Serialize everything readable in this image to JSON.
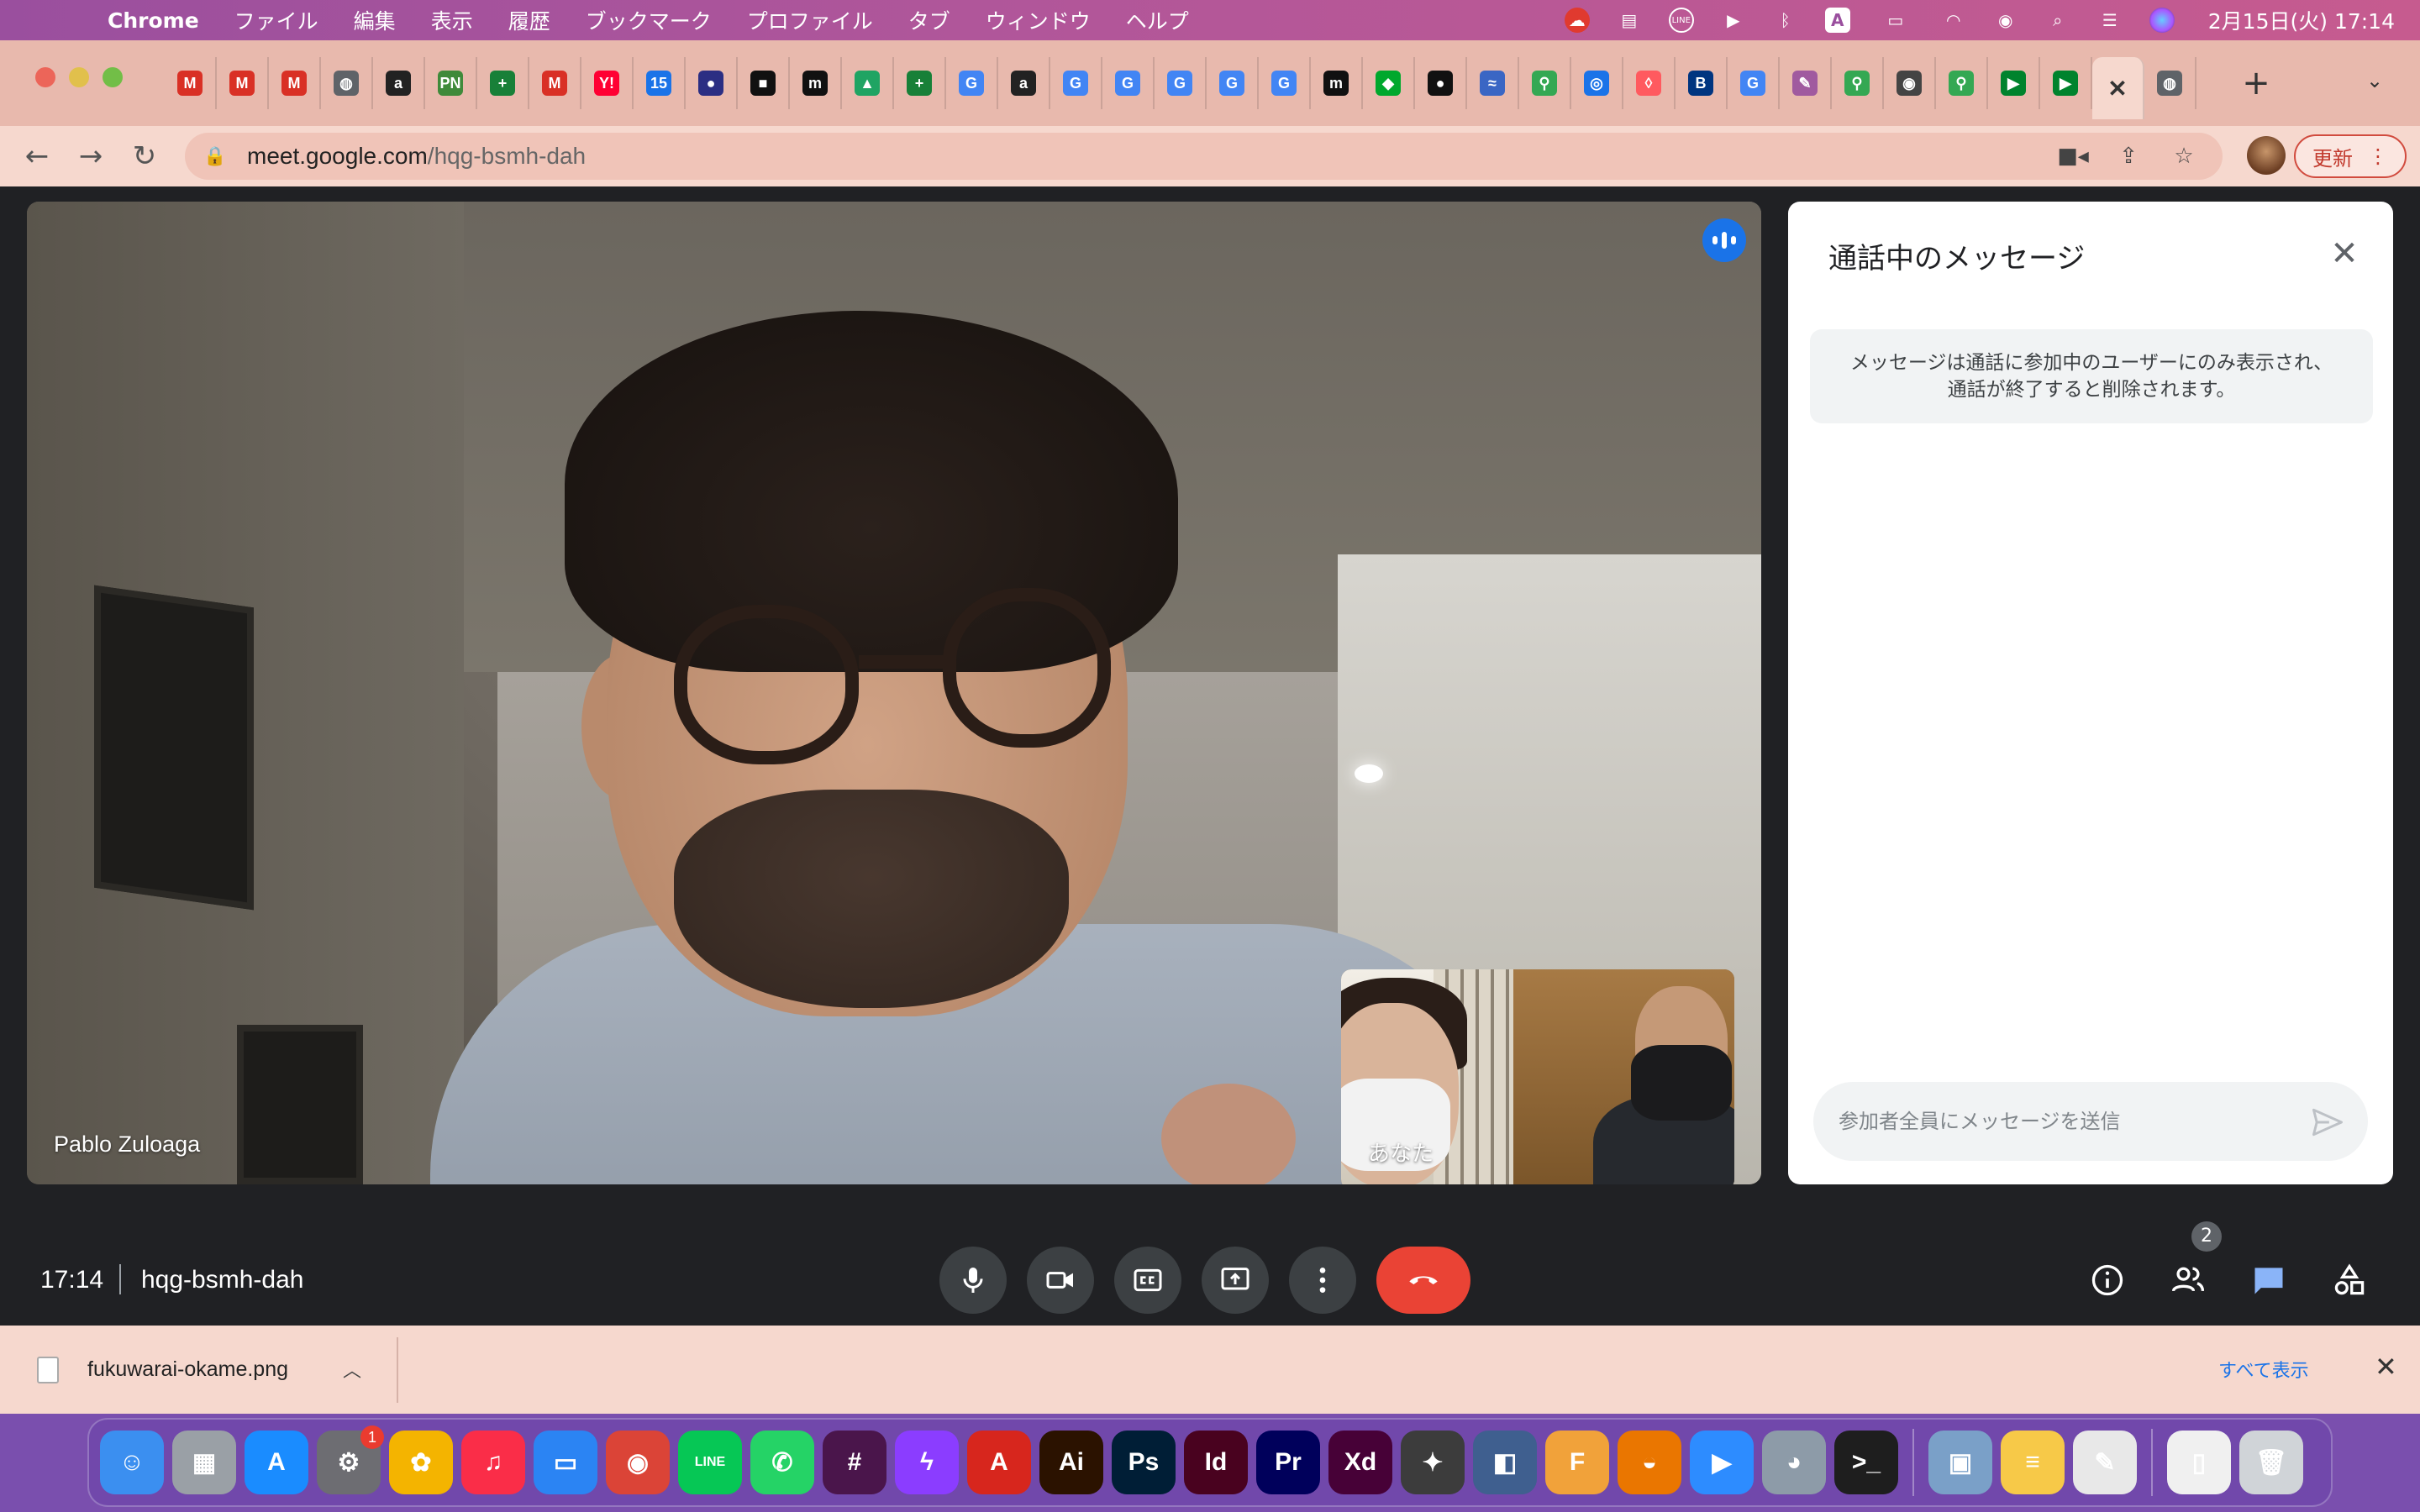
{
  "menubar": {
    "app_name": "Chrome",
    "menus": [
      "ファイル",
      "編集",
      "表示",
      "履歴",
      "ブックマーク",
      "プロファイル",
      "タブ",
      "ウィンドウ",
      "ヘルプ"
    ],
    "status_icons": [
      "creative-cloud-icon",
      "clipboard-icon",
      "line-icon",
      "play-icon",
      "bluetooth-icon",
      "input-method-icon",
      "battery-icon",
      "wifi-icon",
      "user-icon",
      "spotlight-icon",
      "control-center-icon",
      "siri-icon"
    ],
    "input_method_label": "A",
    "clock": "2月15日(火)  17:14"
  },
  "tabs": {
    "favicons": [
      {
        "icon": "gmail-icon",
        "glyph": "M",
        "color": "#d93025"
      },
      {
        "icon": "gmail-icon",
        "glyph": "M",
        "color": "#d93025"
      },
      {
        "icon": "gmail-icon",
        "glyph": "M",
        "color": "#d93025"
      },
      {
        "icon": "globe-icon",
        "glyph": "◍",
        "color": "#5f6368"
      },
      {
        "icon": "amazon-icon",
        "glyph": "a",
        "color": "#222222"
      },
      {
        "icon": "pn-icon",
        "glyph": "PN",
        "color": "#3f8a3a"
      },
      {
        "icon": "sheets-icon",
        "glyph": "+",
        "color": "#188038"
      },
      {
        "icon": "gmail-icon",
        "glyph": "M",
        "color": "#d93025"
      },
      {
        "icon": "yahoo-icon",
        "glyph": "Y!",
        "color": "#ff0033"
      },
      {
        "icon": "calendar-icon",
        "glyph": "15",
        "color": "#1a73e8"
      },
      {
        "icon": "circle-logo-icon",
        "glyph": "●",
        "color": "#2b2e83"
      },
      {
        "icon": "box-icon",
        "glyph": "■",
        "color": "#111111"
      },
      {
        "icon": "miro-icon",
        "glyph": "m",
        "color": "#111111"
      },
      {
        "icon": "drive-icon",
        "glyph": "▲",
        "color": "#1fa463"
      },
      {
        "icon": "sheets-icon",
        "glyph": "+",
        "color": "#188038"
      },
      {
        "icon": "google-icon",
        "glyph": "G",
        "color": "#4285f4"
      },
      {
        "icon": "amazon-icon",
        "glyph": "a",
        "color": "#222222"
      },
      {
        "icon": "google-icon",
        "glyph": "G",
        "color": "#4285f4"
      },
      {
        "icon": "google-icon",
        "glyph": "G",
        "color": "#4285f4"
      },
      {
        "icon": "google-icon",
        "glyph": "G",
        "color": "#4285f4"
      },
      {
        "icon": "google-icon",
        "glyph": "G",
        "color": "#4285f4"
      },
      {
        "icon": "google-icon",
        "glyph": "G",
        "color": "#4285f4"
      },
      {
        "icon": "miro-icon",
        "glyph": "m",
        "color": "#111111"
      },
      {
        "icon": "evernote-icon",
        "glyph": "◆",
        "color": "#00a82d"
      },
      {
        "icon": "dark-circle-icon",
        "glyph": "●",
        "color": "#111111"
      },
      {
        "icon": "ocean-icon",
        "glyph": "≈",
        "color": "#3a66c4"
      },
      {
        "icon": "maps-icon",
        "glyph": "⚲",
        "color": "#34a853"
      },
      {
        "icon": "lens-icon",
        "glyph": "◎",
        "color": "#1a73e8"
      },
      {
        "icon": "airbnb-icon",
        "glyph": "◊",
        "color": "#ff5a5f"
      },
      {
        "icon": "booking-icon",
        "glyph": "B",
        "color": "#003580"
      },
      {
        "icon": "google-icon",
        "glyph": "G",
        "color": "#4285f4"
      },
      {
        "icon": "sketch-icon",
        "glyph": "✎",
        "color": "#a05a9f"
      },
      {
        "icon": "maps-icon",
        "glyph": "⚲",
        "color": "#34a853"
      },
      {
        "icon": "chrome-icon",
        "glyph": "◉",
        "color": "#444444"
      },
      {
        "icon": "maps-icon",
        "glyph": "⚲",
        "color": "#34a853"
      },
      {
        "icon": "meet-icon",
        "glyph": "▶",
        "color": "#00832d"
      },
      {
        "icon": "meet-icon",
        "glyph": "▶",
        "color": "#00832d"
      }
    ],
    "active_tab_glyph": "✕",
    "after_active": {
      "icon": "globe-icon",
      "glyph": "◍",
      "color": "#5f6368"
    },
    "new_tab_glyph": "+",
    "tab_menu_glyph": "⌄"
  },
  "toolbar": {
    "url_host": "meet.google.com",
    "url_path": "/hqg-bsmh-dah",
    "update_label": "更新"
  },
  "meet": {
    "speaker_name": "Pablo Zuloaga",
    "self_label": "あなた",
    "time": "17:14",
    "meeting_code": "hqg-bsmh-dah",
    "participant_count": "2",
    "colors": {
      "end_call": "#ea4335",
      "accent": "#1a73e8",
      "control": "#3c4043",
      "chat_active": "#8ab4f8"
    }
  },
  "chat": {
    "title": "通話中のメッセージ",
    "notice_line1": "メッセージは通話に参加中のユーザーにのみ表示され、",
    "notice_line2": "通話が終了すると削除されます。",
    "input_placeholder": "参加者全員にメッセージを送信",
    "input_value": ""
  },
  "downloads": {
    "file_name": "fukuwarai-okame.png",
    "show_all_label": "すべて表示"
  },
  "dock": {
    "apps": [
      {
        "name": "finder",
        "glyph": "☺",
        "color": "#3b8ff0"
      },
      {
        "name": "launchpad",
        "glyph": "▦",
        "color": "#9aa0a6"
      },
      {
        "name": "app-store",
        "glyph": "A",
        "color": "#1a8cff"
      },
      {
        "name": "system-preferences",
        "glyph": "⚙",
        "color": "#6d6d72",
        "badge": "1"
      },
      {
        "name": "photos",
        "glyph": "✿",
        "color": "#f4b400"
      },
      {
        "name": "music",
        "glyph": "♫",
        "color": "#fa2d48"
      },
      {
        "name": "keynote",
        "glyph": "▭",
        "color": "#2b84f3"
      },
      {
        "name": "chrome",
        "glyph": "◉",
        "color": "#db4437"
      },
      {
        "name": "line",
        "glyph": "LINE",
        "color": "#06c755"
      },
      {
        "name": "whatsapp",
        "glyph": "✆",
        "color": "#25d366"
      },
      {
        "name": "slack",
        "glyph": "#",
        "color": "#4a154b"
      },
      {
        "name": "messenger",
        "glyph": "ϟ",
        "color": "#8b3dff"
      },
      {
        "name": "acrobat",
        "glyph": "A",
        "color": "#d7261d"
      },
      {
        "name": "illustrator",
        "glyph": "Ai",
        "color": "#2b1200"
      },
      {
        "name": "photoshop",
        "glyph": "Ps",
        "color": "#001e36"
      },
      {
        "name": "indesign",
        "glyph": "Id",
        "color": "#49021f"
      },
      {
        "name": "premiere",
        "glyph": "Pr",
        "color": "#00005b"
      },
      {
        "name": "xd",
        "glyph": "Xd",
        "color": "#470137"
      },
      {
        "name": "rhino",
        "glyph": "✦",
        "color": "#3c3c3c"
      },
      {
        "name": "sketchup",
        "glyph": "◧",
        "color": "#3f5f8f"
      },
      {
        "name": "fusion-360",
        "glyph": "F",
        "color": "#f1a23a"
      },
      {
        "name": "blender",
        "glyph": "◒",
        "color": "#ea7600"
      },
      {
        "name": "zoom",
        "glyph": "▶",
        "color": "#2d8cff"
      },
      {
        "name": "google-earth-pro",
        "glyph": "◕",
        "color": "#8d9ba8"
      },
      {
        "name": "terminal",
        "glyph": ">_",
        "color": "#1e1e1e"
      },
      {
        "name": "preview",
        "glyph": "▣",
        "color": "#7aa0c8"
      },
      {
        "name": "notes",
        "glyph": "≡",
        "color": "#f7c948"
      },
      {
        "name": "textedit",
        "glyph": "✎",
        "color": "#e8e8e8"
      },
      {
        "name": "documents-stack",
        "glyph": "▯",
        "color": "#f0f0f0"
      },
      {
        "name": "trash",
        "glyph": "🗑",
        "color": "#d0d4d8"
      }
    ]
  }
}
